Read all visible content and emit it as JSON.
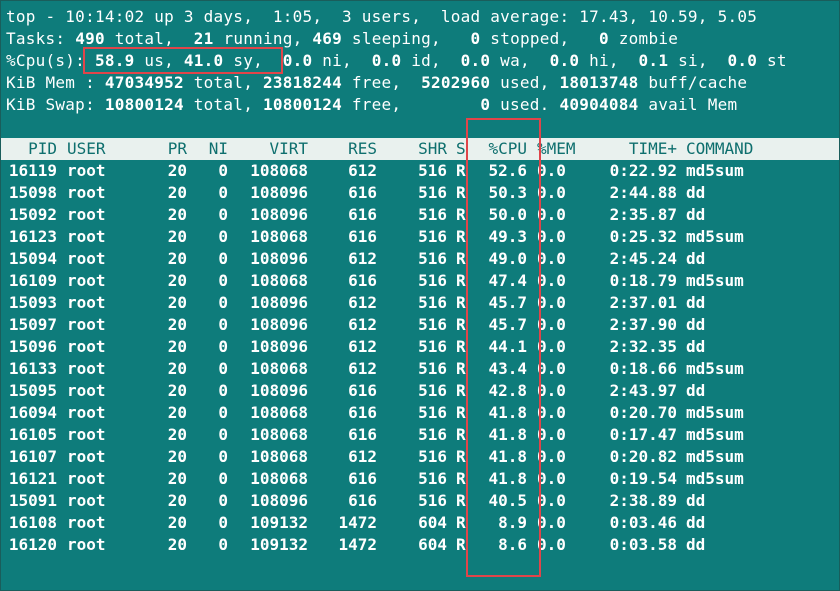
{
  "summary": {
    "line1": "top - 10:14:02 up 3 days,  1:05,  3 users,  load average: 17.43, 10.59, 5.05",
    "tasks_label": "Tasks: ",
    "tasks_total": "490",
    "tasks_total_label": " total,  ",
    "tasks_running": "21",
    "tasks_running_label": " running, ",
    "tasks_sleeping": "469",
    "tasks_sleeping_label": " sleeping,   ",
    "tasks_stopped": "0",
    "tasks_stopped_label": " stopped,   ",
    "tasks_zombie": "0",
    "tasks_zombie_label": " zombie",
    "cpu_label": "%Cpu(s): ",
    "cpu_us": "58.9",
    "cpu_us_label": " us, ",
    "cpu_sy": "41.0",
    "cpu_sy_label": " sy,  ",
    "cpu_ni": "0.0",
    "cpu_ni_label": " ni,  ",
    "cpu_id": "0.0",
    "cpu_id_label": " id,  ",
    "cpu_wa": "0.0",
    "cpu_wa_label": " wa,  ",
    "cpu_hi": "0.0",
    "cpu_hi_label": " hi,  ",
    "cpu_si": "0.1",
    "cpu_si_label": " si,  ",
    "cpu_st": "0.0",
    "cpu_st_label": " st",
    "mem_label": "KiB Mem : ",
    "mem_total": "47034952",
    "mem_total_label": " total, ",
    "mem_free": "23818244",
    "mem_free_label": " free,  ",
    "mem_used": "5202960",
    "mem_used_label": " used, ",
    "mem_buff": "18013748",
    "mem_buff_label": " buff/cache",
    "swap_label": "KiB Swap: ",
    "swap_total": "10800124",
    "swap_total_label": " total, ",
    "swap_free": "10800124",
    "swap_free_label": " free,        ",
    "swap_used": "0",
    "swap_used_label": " used. ",
    "swap_avail": "40904084",
    "swap_avail_label": " avail Mem"
  },
  "columns": [
    "PID",
    "USER",
    "PR",
    "NI",
    "VIRT",
    "RES",
    "SHR",
    "S",
    "%CPU",
    "%MEM",
    "TIME+",
    "COMMAND"
  ],
  "processes": [
    [
      "16119",
      "root",
      "20",
      "0",
      "108068",
      "612",
      "516",
      "R",
      "52.6",
      "0.0",
      "0:22.92",
      "md5sum"
    ],
    [
      "15098",
      "root",
      "20",
      "0",
      "108096",
      "616",
      "516",
      "R",
      "50.3",
      "0.0",
      "2:44.88",
      "dd"
    ],
    [
      "15092",
      "root",
      "20",
      "0",
      "108096",
      "616",
      "516",
      "R",
      "50.0",
      "0.0",
      "2:35.87",
      "dd"
    ],
    [
      "16123",
      "root",
      "20",
      "0",
      "108068",
      "616",
      "516",
      "R",
      "49.3",
      "0.0",
      "0:25.32",
      "md5sum"
    ],
    [
      "15094",
      "root",
      "20",
      "0",
      "108096",
      "612",
      "516",
      "R",
      "49.0",
      "0.0",
      "2:45.24",
      "dd"
    ],
    [
      "16109",
      "root",
      "20",
      "0",
      "108068",
      "616",
      "516",
      "R",
      "47.4",
      "0.0",
      "0:18.79",
      "md5sum"
    ],
    [
      "15093",
      "root",
      "20",
      "0",
      "108096",
      "612",
      "516",
      "R",
      "45.7",
      "0.0",
      "2:37.01",
      "dd"
    ],
    [
      "15097",
      "root",
      "20",
      "0",
      "108096",
      "612",
      "516",
      "R",
      "45.7",
      "0.0",
      "2:37.90",
      "dd"
    ],
    [
      "15096",
      "root",
      "20",
      "0",
      "108096",
      "612",
      "516",
      "R",
      "44.1",
      "0.0",
      "2:32.35",
      "dd"
    ],
    [
      "16133",
      "root",
      "20",
      "0",
      "108068",
      "612",
      "516",
      "R",
      "43.4",
      "0.0",
      "0:18.66",
      "md5sum"
    ],
    [
      "15095",
      "root",
      "20",
      "0",
      "108096",
      "616",
      "516",
      "R",
      "42.8",
      "0.0",
      "2:43.97",
      "dd"
    ],
    [
      "16094",
      "root",
      "20",
      "0",
      "108068",
      "616",
      "516",
      "R",
      "41.8",
      "0.0",
      "0:20.70",
      "md5sum"
    ],
    [
      "16105",
      "root",
      "20",
      "0",
      "108068",
      "616",
      "516",
      "R",
      "41.8",
      "0.0",
      "0:17.47",
      "md5sum"
    ],
    [
      "16107",
      "root",
      "20",
      "0",
      "108068",
      "612",
      "516",
      "R",
      "41.8",
      "0.0",
      "0:20.82",
      "md5sum"
    ],
    [
      "16121",
      "root",
      "20",
      "0",
      "108068",
      "616",
      "516",
      "R",
      "41.8",
      "0.0",
      "0:19.54",
      "md5sum"
    ],
    [
      "15091",
      "root",
      "20",
      "0",
      "108096",
      "616",
      "516",
      "R",
      "40.5",
      "0.0",
      "2:38.89",
      "dd"
    ],
    [
      "16108",
      "root",
      "20",
      "0",
      "109132",
      "1472",
      "604",
      "R",
      "8.9",
      "0.0",
      "0:03.46",
      "dd"
    ],
    [
      "16120",
      "root",
      "20",
      "0",
      "109132",
      "1472",
      "604",
      "R",
      "8.6",
      "0.0",
      "0:03.58",
      "dd"
    ]
  ],
  "colors": {
    "terminal_bg": "#0e7c7b",
    "header_bg": "#e9f1ee",
    "header_fg": "#0e6f6e",
    "highlight": "#e0454a"
  }
}
